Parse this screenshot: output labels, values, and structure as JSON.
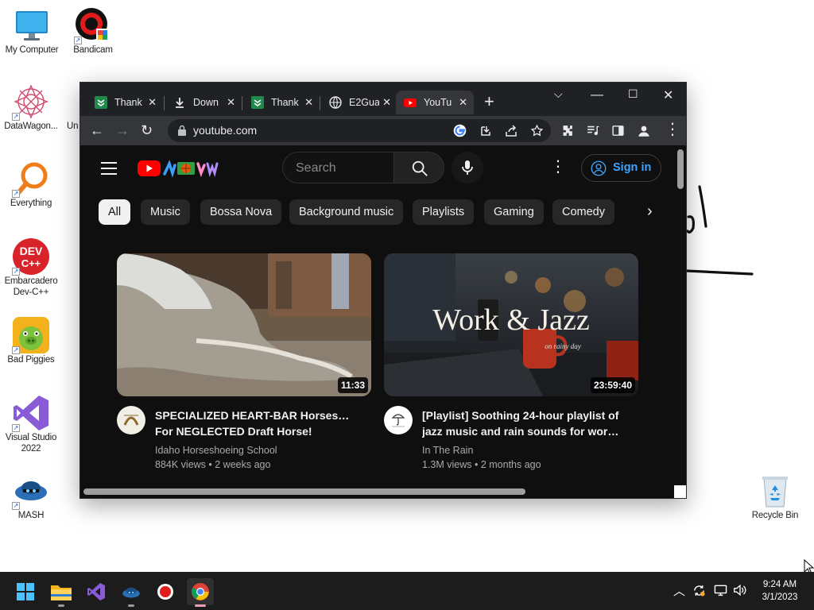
{
  "desktop": {
    "icons": [
      {
        "label": "My Computer",
        "icon": "monitor-icon"
      },
      {
        "label": "Bandicam",
        "icon": "bandicam-icon"
      },
      {
        "label": "DataWagon...",
        "icon": "datawagon-icon"
      },
      {
        "label": "Un",
        "icon": "partial-icon"
      },
      {
        "label": "Everything",
        "icon": "everything-search-icon"
      },
      {
        "label": "Embarcadero Dev-C++",
        "icon": "devcpp-icon"
      },
      {
        "label": "Bad Piggies",
        "icon": "bad-piggies-icon"
      },
      {
        "label": "Visual Studio 2022",
        "icon": "visual-studio-icon"
      },
      {
        "label": "MASH",
        "icon": "mash-icon"
      },
      {
        "label": "Recycle Bin",
        "icon": "recycle-bin-icon"
      }
    ]
  },
  "browser": {
    "tabs": [
      {
        "label": "Thank",
        "icon": "e2guardian-icon",
        "active": false
      },
      {
        "label": "Down",
        "icon": "download-icon",
        "active": false
      },
      {
        "label": "Thank",
        "icon": "e2guardian-icon",
        "active": false
      },
      {
        "label": "E2Gua",
        "icon": "globe-icon",
        "active": false
      },
      {
        "label": "YouTu",
        "icon": "youtube-icon",
        "active": true
      }
    ],
    "url": "youtube.com"
  },
  "youtube": {
    "search_placeholder": "Search",
    "sign_in": "Sign in",
    "chips": [
      "All",
      "Music",
      "Bossa Nova",
      "Background music",
      "Playlists",
      "Gaming",
      "Comedy"
    ],
    "videos": [
      {
        "title_line1": "SPECIALIZED HEART-BAR Horseshoe",
        "title_line2": "For NEGLECTED Draft Horse!",
        "channel": "Idaho Horseshoeing School",
        "meta": "884K views • 2 weeks ago",
        "duration": "11:33"
      },
      {
        "title_line1": "[Playlist] Soothing 24-hour playlist of",
        "title_line2": "jazz music and rain sounds for work...",
        "channel": "In The Rain",
        "meta": "1.3M views • 2 months ago",
        "duration": "23:59:40",
        "thumb_text": "Work & Jazz",
        "thumb_subtext": "on rainy day"
      }
    ]
  },
  "taskbar": {
    "apps": [
      "windows-start-icon",
      "file-explorer-icon",
      "visual-studio-icon",
      "mash-icon",
      "bandicam-icon",
      "chrome-icon"
    ],
    "time": "9:24 AM",
    "date": "3/1/2023"
  }
}
